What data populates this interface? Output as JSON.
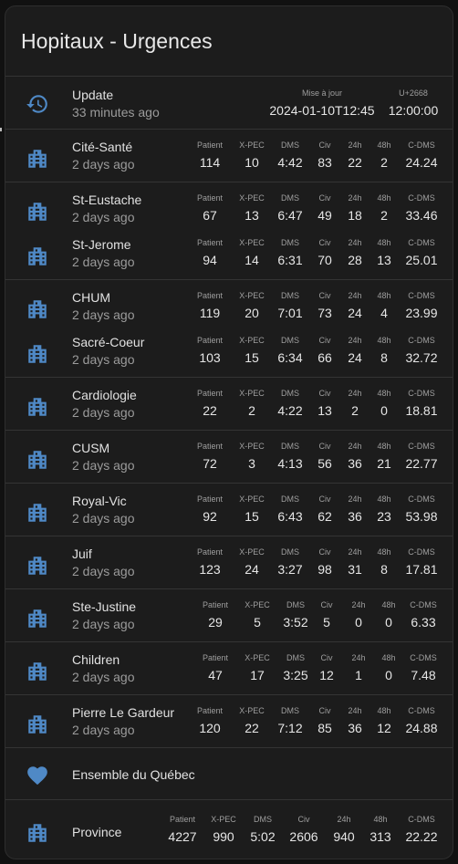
{
  "title": "Hopitaux - Urgences",
  "colors": {
    "icon": "#4f89c6",
    "background": "#1c1c1c",
    "divider": "#343434"
  },
  "update": {
    "label": "Update",
    "ago": "33 minutes ago",
    "col1_header": "Mise à jour",
    "col1_value": "2024-01-10T12:45",
    "col2_header": "U+2668",
    "col2_value": "12:00:00"
  },
  "stat_headers": [
    "Patient",
    "X-PEC",
    "DMS",
    "Civ",
    "24h",
    "48h",
    "C-DMS"
  ],
  "hospitals": [
    {
      "name": "Cité-Santé",
      "ago": "2 days ago",
      "values": [
        "114",
        "10",
        "4:42",
        "83",
        "22",
        "2",
        "24.24"
      ]
    },
    {
      "name": "St-Eustache",
      "ago": "2 days ago",
      "values": [
        "67",
        "13",
        "6:47",
        "49",
        "18",
        "2",
        "33.46"
      ]
    },
    {
      "name": "St-Jerome",
      "ago": "2 days ago",
      "values": [
        "94",
        "14",
        "6:31",
        "70",
        "28",
        "13",
        "25.01"
      ]
    },
    {
      "name": "CHUM",
      "ago": "2 days ago",
      "values": [
        "119",
        "20",
        "7:01",
        "73",
        "24",
        "4",
        "23.99"
      ]
    },
    {
      "name": "Sacré-Coeur",
      "ago": "2 days ago",
      "values": [
        "103",
        "15",
        "6:34",
        "66",
        "24",
        "8",
        "32.72"
      ]
    },
    {
      "name": "Cardiologie",
      "ago": "2 days ago",
      "values": [
        "22",
        "2",
        "4:22",
        "13",
        "2",
        "0",
        "18.81"
      ]
    },
    {
      "name": "CUSM",
      "ago": "2 days ago",
      "values": [
        "72",
        "3",
        "4:13",
        "56",
        "36",
        "21",
        "22.77"
      ]
    },
    {
      "name": "Royal-Vic",
      "ago": "2 days ago",
      "values": [
        "92",
        "15",
        "6:43",
        "62",
        "36",
        "23",
        "53.98"
      ]
    },
    {
      "name": "Juif",
      "ago": "2 days ago",
      "values": [
        "123",
        "24",
        "3:27",
        "98",
        "31",
        "8",
        "17.81"
      ]
    },
    {
      "name": "Ste-Justine",
      "ago": "2 days ago",
      "values": [
        "29",
        "5",
        "3:52",
        "5",
        "0",
        "0",
        "6.33"
      ]
    },
    {
      "name": "Children",
      "ago": "2 days ago",
      "values": [
        "47",
        "17",
        "3:25",
        "12",
        "1",
        "0",
        "7.48"
      ]
    },
    {
      "name": "Pierre Le Gardeur",
      "ago": "2 days ago",
      "values": [
        "120",
        "22",
        "7:12",
        "85",
        "36",
        "12",
        "24.88"
      ]
    }
  ],
  "section": {
    "label": "Ensemble du Québec"
  },
  "province": {
    "name": "Province",
    "values": [
      "4227",
      "990",
      "5:02",
      "2606",
      "940",
      "313",
      "22.22"
    ]
  }
}
